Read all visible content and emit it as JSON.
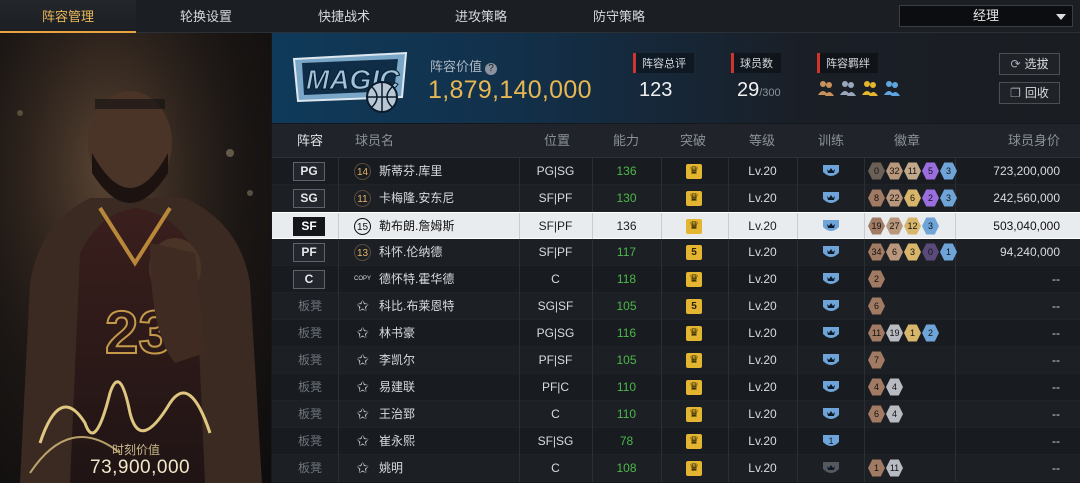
{
  "nav": {
    "tabs": [
      "阵容管理",
      "轮换设置",
      "快捷战术",
      "进攻策略",
      "防守策略"
    ],
    "active_tab": 0,
    "role_select": "经理"
  },
  "card": {
    "value_label": "时刻价值",
    "value": "73,900,000",
    "jersey_number": "23"
  },
  "header": {
    "lineup_value_label": "阵容价值",
    "lineup_value": "1,879,140,000",
    "total_rating_label": "阵容总评",
    "total_rating": "123",
    "players_label": "球员数",
    "players_count": "29",
    "players_max": "/300",
    "bonds_label": "阵容羁绊",
    "btn_select": "选拔",
    "btn_recycle": "回收",
    "icon_colors": {
      "bond1": "#c8925a",
      "bond2": "#9aa8bb",
      "bond3": "#e3b72d",
      "bond4": "#5fa6e0"
    }
  },
  "table": {
    "headers": [
      "阵容",
      "球员名",
      "位置",
      "能力",
      "突破",
      "等级",
      "训练",
      "徽章",
      "球员身价"
    ],
    "rows": [
      {
        "slot": "PG",
        "bench": false,
        "jersey": "14",
        "name": "斯蒂芬.库里",
        "pos": "PG|SG",
        "ability": "136",
        "breakthrough": "",
        "level": "Lv.20",
        "badges": [
          [
            "0",
            "#6b6056"
          ],
          [
            "32",
            "#b8977c"
          ],
          [
            "11",
            "#c0a88a"
          ],
          [
            "5",
            "#9b6ee0"
          ],
          [
            "3",
            "#6fa4d8"
          ]
        ],
        "worth": "723,200,000",
        "selected": false
      },
      {
        "slot": "SG",
        "bench": false,
        "jersey": "11",
        "name": "卡梅隆.安东尼",
        "pos": "SF|PF",
        "ability": "130",
        "breakthrough": "",
        "level": "Lv.20",
        "badges": [
          [
            "8",
            "#a07a62"
          ],
          [
            "22",
            "#b8977c"
          ],
          [
            "6",
            "#d7b56a"
          ],
          [
            "2",
            "#9b6ee0"
          ],
          [
            "3",
            "#6fa4d8"
          ]
        ],
        "worth": "242,560,000",
        "selected": false
      },
      {
        "slot": "SF",
        "bench": false,
        "jersey": "15",
        "name": "勒布朗.詹姆斯",
        "pos": "SF|PF",
        "ability": "136",
        "breakthrough": "",
        "level": "Lv.20",
        "badges": [
          [
            "19",
            "#a07a62"
          ],
          [
            "27",
            "#b8977c"
          ],
          [
            "12",
            "#d7b56a"
          ],
          [
            "3",
            "#6fa4d8"
          ]
        ],
        "worth": "503,040,000",
        "selected": true
      },
      {
        "slot": "PF",
        "bench": false,
        "jersey": "13",
        "name": "科怀.伦纳德",
        "pos": "SF|PF",
        "ability": "117",
        "breakthrough": "5",
        "level": "Lv.20",
        "badges": [
          [
            "34",
            "#a07a62"
          ],
          [
            "6",
            "#b8977c"
          ],
          [
            "3",
            "#d7b56a"
          ],
          [
            "0",
            "#5a4a7a"
          ],
          [
            "1",
            "#6fa4d8"
          ]
        ],
        "worth": "94,240,000",
        "selected": false
      },
      {
        "slot": "C",
        "bench": false,
        "jersey": "COPY",
        "name": "德怀特.霍华德",
        "pos": "C",
        "ability": "118",
        "breakthrough": "",
        "level": "Lv.20",
        "badges": [
          [
            "2",
            "#a07a62"
          ]
        ],
        "worth": "--",
        "selected": false
      },
      {
        "slot": "板凳",
        "bench": true,
        "jersey": "",
        "name": "科比.布莱恩特",
        "pos": "SG|SF",
        "ability": "105",
        "breakthrough": "5",
        "level": "Lv.20",
        "badges": [
          [
            "6",
            "#a07a62"
          ]
        ],
        "worth": "--",
        "selected": false
      },
      {
        "slot": "板凳",
        "bench": true,
        "jersey": "",
        "name": "林书豪",
        "pos": "PG|SG",
        "ability": "116",
        "breakthrough": "",
        "level": "Lv.20",
        "badges": [
          [
            "11",
            "#a07a62"
          ],
          [
            "19",
            "#b8bcc2"
          ],
          [
            "1",
            "#d7b56a"
          ],
          [
            "2",
            "#6fa4d8"
          ]
        ],
        "worth": "--",
        "selected": false
      },
      {
        "slot": "板凳",
        "bench": true,
        "jersey": "",
        "name": "李凯尔",
        "pos": "PF|SF",
        "ability": "105",
        "breakthrough": "",
        "level": "Lv.20",
        "badges": [
          [
            "7",
            "#a07a62"
          ]
        ],
        "worth": "--",
        "selected": false
      },
      {
        "slot": "板凳",
        "bench": true,
        "jersey": "",
        "name": "易建联",
        "pos": "PF|C",
        "ability": "110",
        "breakthrough": "",
        "level": "Lv.20",
        "badges": [
          [
            "4",
            "#a07a62"
          ],
          [
            "4",
            "#b8bcc2"
          ]
        ],
        "worth": "--",
        "selected": false
      },
      {
        "slot": "板凳",
        "bench": true,
        "jersey": "",
        "name": "王治郅",
        "pos": "C",
        "ability": "110",
        "breakthrough": "",
        "level": "Lv.20",
        "badges": [
          [
            "6",
            "#a07a62"
          ],
          [
            "4",
            "#b8bcc2"
          ]
        ],
        "worth": "--",
        "selected": false
      },
      {
        "slot": "板凳",
        "bench": true,
        "jersey": "",
        "name": "崔永熙",
        "pos": "SF|SG",
        "ability": "78",
        "breakthrough": "",
        "level": "Lv.20",
        "badges": [],
        "worth": "--",
        "selected": false,
        "training": "1"
      },
      {
        "slot": "板凳",
        "bench": true,
        "jersey": "",
        "name": "姚明",
        "pos": "C",
        "ability": "108",
        "breakthrough": "",
        "level": "Lv.20",
        "badges": [
          [
            "1",
            "#a07a62"
          ],
          [
            "11",
            "#b8bcc2"
          ]
        ],
        "worth": "--",
        "selected": false
      }
    ]
  }
}
